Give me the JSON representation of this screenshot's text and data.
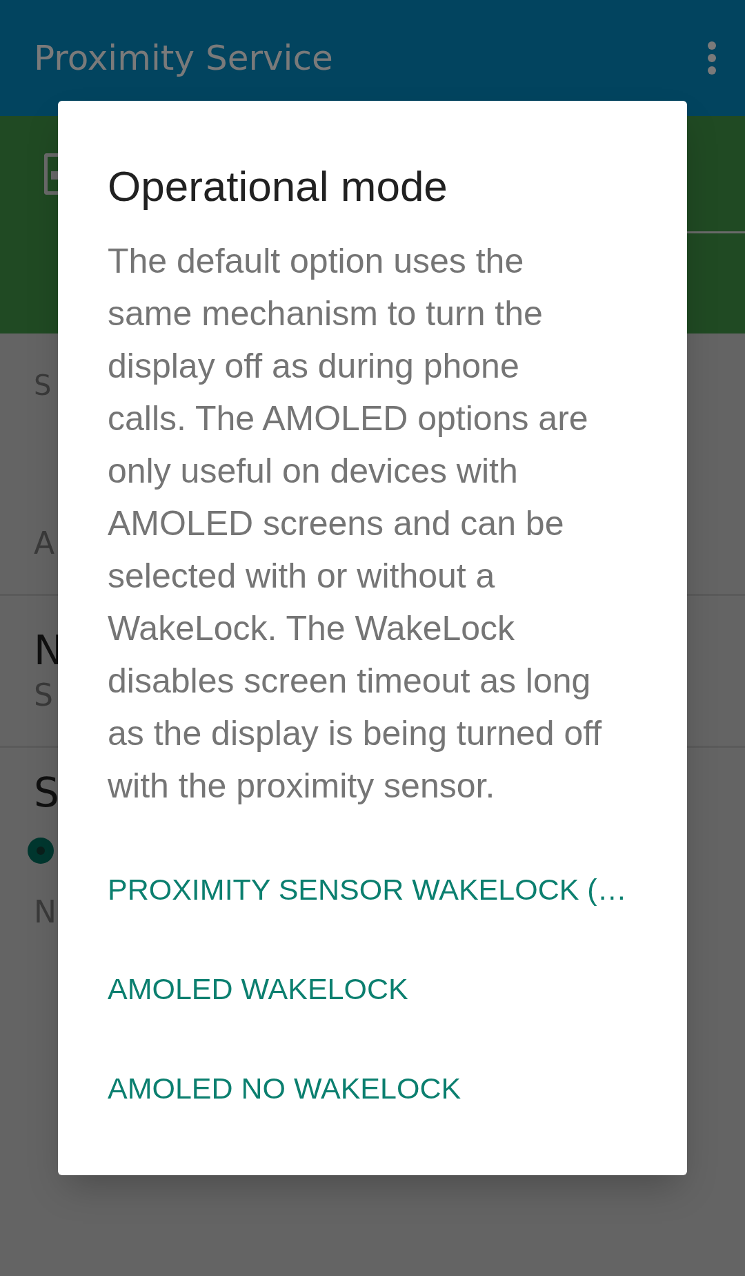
{
  "app_bar": {
    "title": "Proximity Service"
  },
  "section_header": "S",
  "settings": [
    {
      "kind": "text",
      "summary": "A"
    },
    {
      "kind": "text",
      "title": "N",
      "summary": "S"
    },
    {
      "kind": "radio",
      "title": "S",
      "selected": true,
      "note": "N"
    }
  ],
  "dialog": {
    "title": "Operational mode",
    "message": "The default option uses the same mechanism to turn the display off as during phone calls. The AMOLED options are only useful on devices with AMOLED screens and can be selected with or without a WakeLock. The WakeLock disables screen timeout as long as the display is being turned off with the proximity sensor.",
    "buttons": [
      "PROXIMITY SENSOR WAKELOCK (…",
      "AMOLED WAKELOCK",
      "AMOLED NO WAKELOCK"
    ]
  }
}
